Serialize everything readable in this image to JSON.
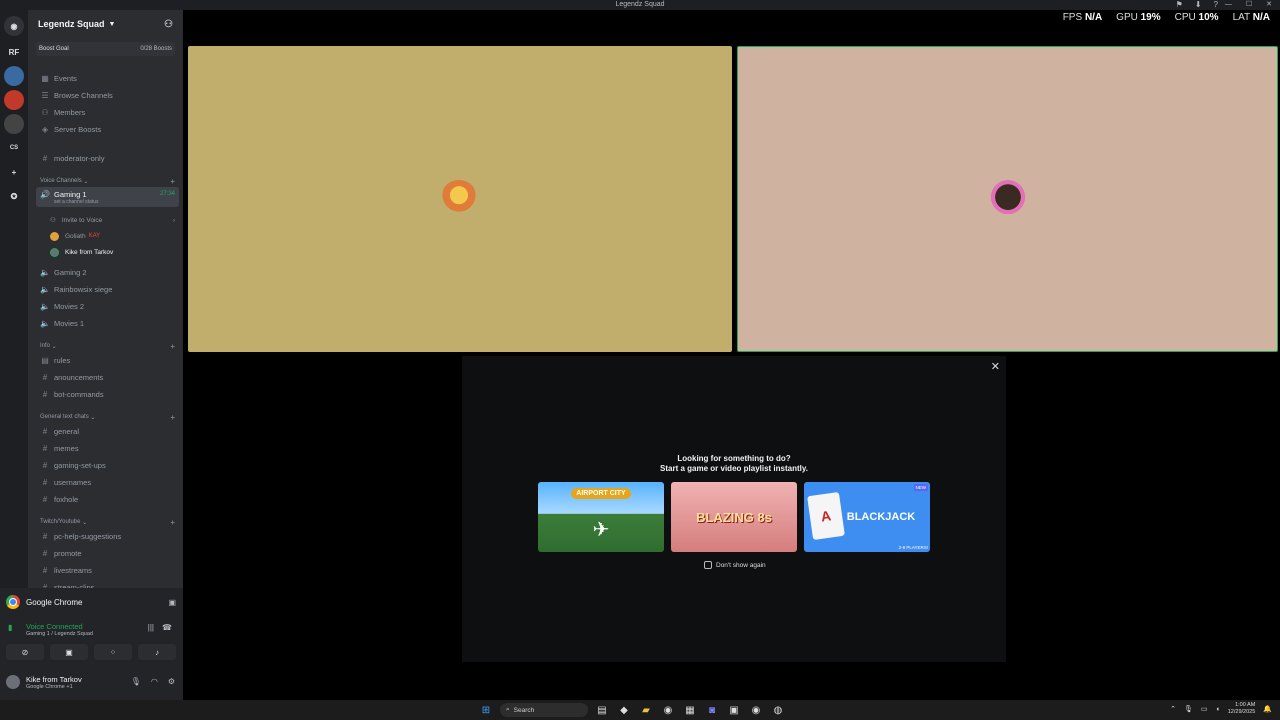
{
  "window": {
    "title": "Legendz Squad",
    "minimize": "—",
    "maximize": "☐",
    "close": "✕"
  },
  "rail": {
    "servers": [
      "RF",
      "CS"
    ]
  },
  "guild": {
    "name": "Legendz Squad",
    "boost_goal": "Boost Goal",
    "boost_count": "0/28 Boosts"
  },
  "nav_items": [
    "Events",
    "Browse Channels",
    "Members",
    "Server Boosts"
  ],
  "top_channel": "moderator-only",
  "voice_category": "Voice Channels",
  "active_voice": {
    "name": "Gaming 1",
    "status": "set a channel status",
    "timer": "27:34"
  },
  "invite": "Invite to Voice",
  "members": [
    {
      "name": "Goliath",
      "tag": "KAY"
    },
    {
      "name": "Kike from Tarkov"
    }
  ],
  "voice_channels": [
    "Gaming 2",
    "Rainbowsix siege",
    "Movies 2",
    "Movies 1"
  ],
  "info_category": "Info",
  "info_channels": [
    "rules",
    "anouncements",
    "bot-commands"
  ],
  "general_category": "General text chats",
  "general_channels": [
    "general",
    "memes",
    "gaming-set-ups",
    "usernames",
    "foxhole"
  ],
  "twitch_category": "Twitch/Youtube",
  "twitch_channels": [
    "pc-help-suggestions",
    "promote",
    "livestreams",
    "stream-clips"
  ],
  "stream_app": "Google Chrome",
  "voice_status": {
    "label": "Voice Connected",
    "channel": "Gaming 1 / Legendz Squad"
  },
  "user": {
    "name": "Kike from Tarkov",
    "status": "Google Chrome +1"
  },
  "stats": {
    "fps_label": "FPS",
    "fps": "N/A",
    "gpu_label": "GPU",
    "gpu": "19%",
    "cpu_label": "CPU",
    "cpu": "10%",
    "lat_label": "LAT",
    "lat": "N/A"
  },
  "shelf": {
    "line1": "Looking for something to do?",
    "line2": "Start a game or video playlist instantly.",
    "games": [
      "AIRPORT CITY",
      "BLAZING 8s",
      "BLACKJACK"
    ],
    "blackjack_tag": "2-8 PLAYERS!",
    "blackjack_badge": "NEW",
    "dont_show": "Don't show again"
  },
  "taskbar": {
    "search": "Search",
    "time": "1:00 AM",
    "date": "12/29/2025"
  },
  "colors": {
    "accent_green": "#23a55a",
    "sidebar": "#2b2d31",
    "tile_left": "#c1ae6d",
    "tile_right": "#d0b2a1"
  }
}
